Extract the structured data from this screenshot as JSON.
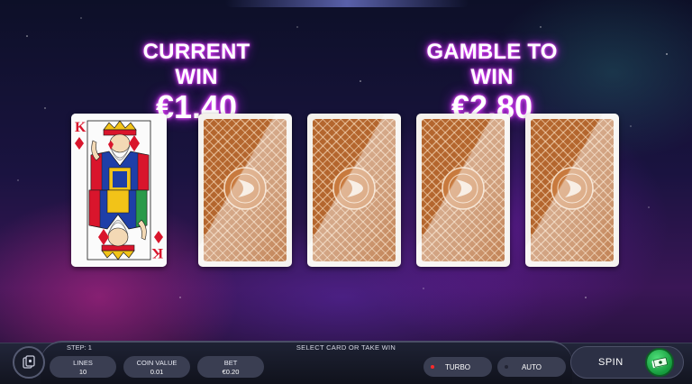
{
  "header": {
    "current_win_label": "CURRENT WIN",
    "current_win_value": "€1.40",
    "gamble_label": "GAMBLE TO WIN",
    "gamble_value": "€2.80"
  },
  "cards": {
    "revealed": {
      "rank": "K",
      "suit": "diamonds",
      "suit_color": "#d9152c"
    },
    "face_down_count": 4,
    "back_color": "#b4662e"
  },
  "bottom_bar": {
    "step": "STEP: 1",
    "message": "SELECT CARD OR TAKE WIN",
    "lines_label": "LINES",
    "lines_value": "10",
    "coin_label": "COIN VALUE",
    "coin_value": "0.01",
    "bet_label": "BET",
    "bet_value": "€0.20",
    "turbo_label": "TURBO",
    "auto_label": "AUTO",
    "spin_label": "SPIN",
    "turbo_dot_color": "#ff2a2a",
    "auto_dot_color": "#222433",
    "spin_color": "#2bbf52"
  },
  "icons": [
    "menu-icon",
    "cash-icon",
    "logo-icon"
  ]
}
